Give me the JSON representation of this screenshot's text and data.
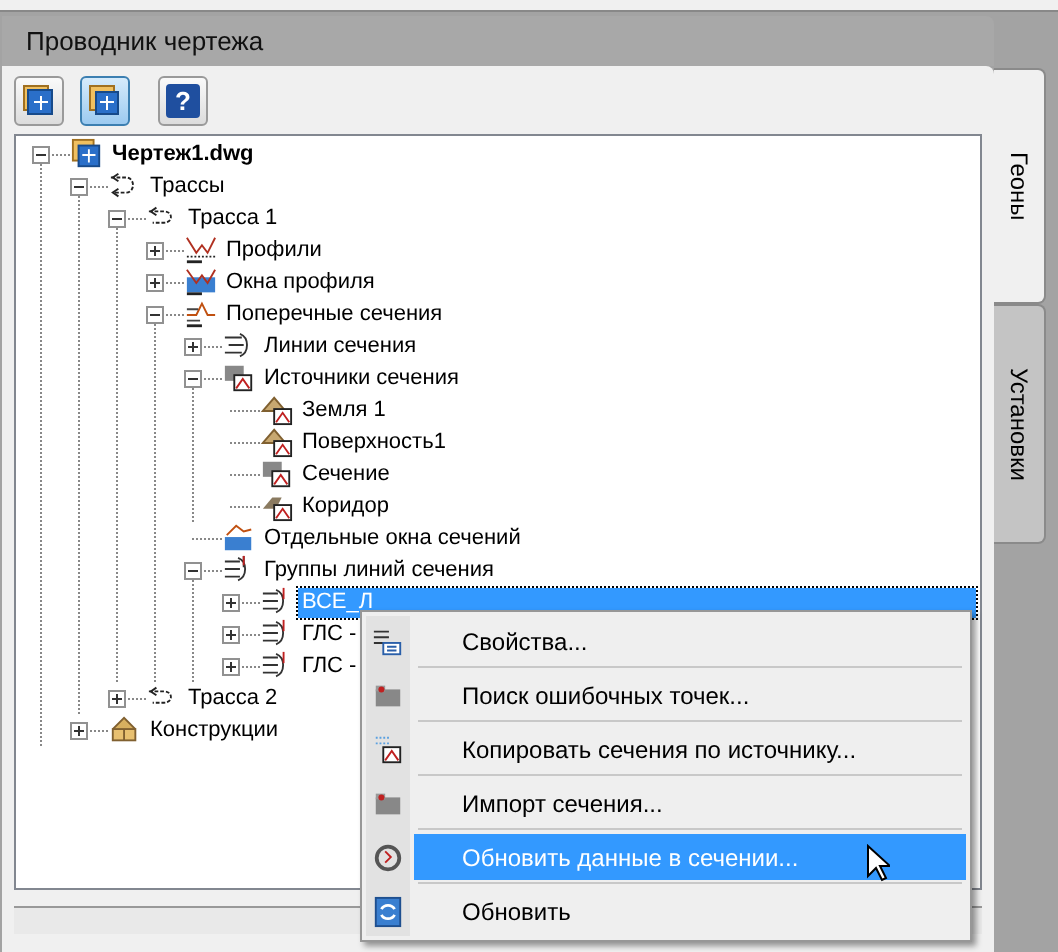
{
  "panel": {
    "title": "Проводник чертежа"
  },
  "toolbar": [
    {
      "kind": "prospector",
      "selected": false
    },
    {
      "kind": "master-view",
      "selected": true
    },
    {
      "kind": "help",
      "label": "?",
      "selected": false
    }
  ],
  "tree": [
    {
      "label": "Чертеж1.dwg",
      "kind": "drawing",
      "expanded": true,
      "selected": false,
      "children": [
        {
          "label": "Трассы",
          "kind": "alignments",
          "expanded": true,
          "selected": false,
          "children": [
            {
              "label": "Трасса 1",
              "kind": "alignment",
              "expanded": true,
              "selected": false,
              "children": [
                {
                  "label": "Профили",
                  "kind": "profiles",
                  "expanded": false,
                  "selected": false
                },
                {
                  "label": "Окна профиля",
                  "kind": "profile-views",
                  "expanded": false,
                  "selected": false
                },
                {
                  "label": "Поперечные сечения",
                  "kind": "sections",
                  "expanded": true,
                  "selected": false,
                  "children": [
                    {
                      "label": "Линии сечения",
                      "kind": "sample-lines",
                      "expanded": false,
                      "selected": false
                    },
                    {
                      "label": "Источники сечения",
                      "kind": "sources",
                      "expanded": true,
                      "selected": false,
                      "children": [
                        {
                          "label": "Земля 1",
                          "kind": "surface",
                          "selected": false
                        },
                        {
                          "label": "Поверхность1",
                          "kind": "surface",
                          "selected": false
                        },
                        {
                          "label": "Сечение",
                          "kind": "source",
                          "selected": false
                        },
                        {
                          "label": "Коридор",
                          "kind": "corridor",
                          "selected": false
                        }
                      ]
                    },
                    {
                      "label": "Отдельные окна сечений",
                      "kind": "section-views",
                      "selected": false
                    },
                    {
                      "label": "Группы линий сечения",
                      "kind": "sample-groups",
                      "expanded": true,
                      "selected": false,
                      "children": [
                        {
                          "label": "ВСЕ_Л",
                          "kind": "sample-group",
                          "expanded": false,
                          "selected": true
                        },
                        {
                          "label": "ГЛС -",
                          "kind": "sample-group",
                          "expanded": false,
                          "selected": false
                        },
                        {
                          "label": "ГЛС -",
                          "kind": "sample-group",
                          "expanded": false,
                          "selected": false
                        }
                      ]
                    }
                  ]
                }
              ]
            },
            {
              "label": "Трасса 2",
              "kind": "alignment",
              "expanded": false,
              "selected": false
            }
          ]
        },
        {
          "label": "Конструкции",
          "kind": "assemblies",
          "expanded": false,
          "selected": false
        }
      ]
    }
  ],
  "context_menu": [
    {
      "label": "Свойства...",
      "kind": "properties",
      "selected": false
    },
    {
      "label": "Поиск ошибочных точек...",
      "kind": "find",
      "selected": false
    },
    {
      "label": "Копировать сечения по источнику...",
      "kind": "copy",
      "selected": false
    },
    {
      "label": "Импорт сечения...",
      "kind": "import",
      "selected": false
    },
    {
      "label": "Обновить данные в сечении...",
      "kind": "update",
      "selected": true
    },
    {
      "label": "Обновить",
      "kind": "refresh",
      "selected": false
    }
  ],
  "side_tabs": [
    {
      "label": "Геоны",
      "selected": true
    },
    {
      "label": "Установки",
      "selected": false
    }
  ]
}
